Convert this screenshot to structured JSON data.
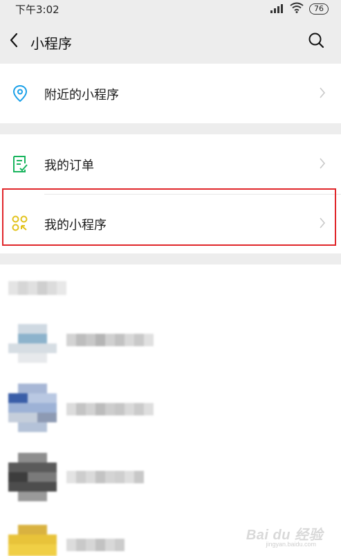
{
  "status_bar": {
    "time": "下午3:02",
    "battery": "76",
    "icons": [
      "signal-icon",
      "wifi-icon",
      "battery-icon"
    ]
  },
  "nav": {
    "title": "小程序",
    "back_icon": "back-arrow-icon",
    "search_icon": "search-icon"
  },
  "sections": {
    "nearby": {
      "label": "附近的小程序",
      "icon": "location-pin-icon",
      "icon_color": "#1aa0e8"
    },
    "orders": {
      "label": "我的订单",
      "icon": "order-list-icon",
      "icon_color": "#18b45d"
    },
    "my_programs": {
      "label": "我的小程序",
      "icon": "mini-program-icon",
      "icon_color": "#e2c21b"
    }
  },
  "highlight_color": "#e0262a",
  "watermark": {
    "text": "Bai du 经验",
    "sub": "jingyan.baidu.com"
  }
}
